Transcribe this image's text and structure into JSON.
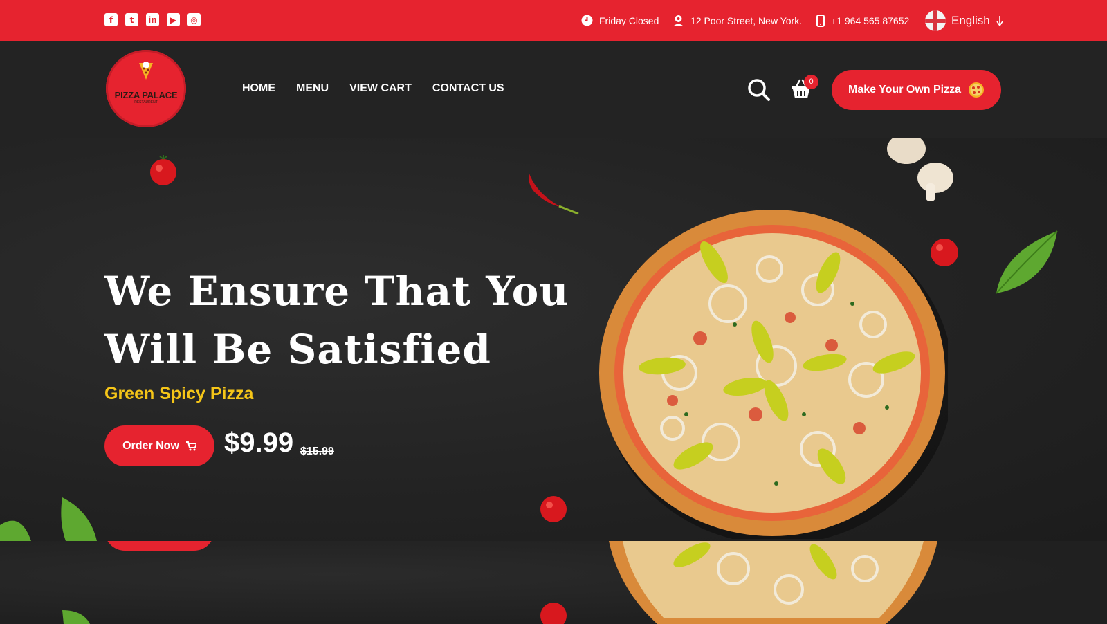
{
  "topbar": {
    "socials": [
      "facebook-icon",
      "twitter-icon",
      "linkedin-icon",
      "youtube-icon",
      "instagram-icon"
    ],
    "hours": "Friday Closed",
    "address": "12 Poor Street, New York.",
    "phone": "+1 964 565 87652",
    "language": "English"
  },
  "logo": {
    "name": "PIZZA PALACE",
    "sub": "RESTAURENT"
  },
  "nav": {
    "items": [
      "HOME",
      "MENU",
      "VIEW CART",
      "CONTACT US"
    ]
  },
  "cart": {
    "count": "0"
  },
  "cta": {
    "label": "Make Your Own Pizza"
  },
  "hero": {
    "headline_line1": "We Ensure That You",
    "headline_line2": "Will Be Satisfied",
    "subtitle": "Green Spicy Pizza",
    "order_label": "Order Now",
    "price": "$9.99",
    "old_price": "$15.99"
  },
  "colors": {
    "brand_red": "#e6232f",
    "accent_yellow": "#f5c518",
    "nav_bg": "#232323"
  }
}
